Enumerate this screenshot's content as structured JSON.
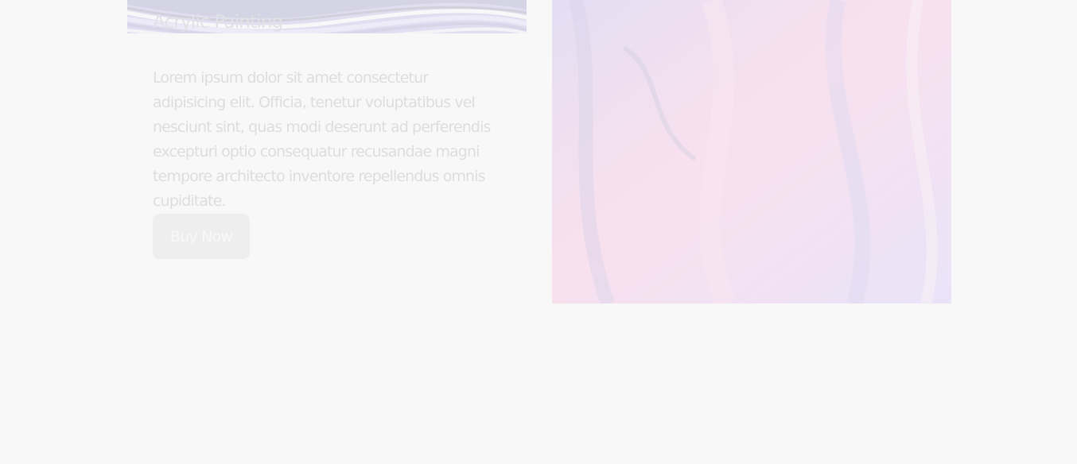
{
  "card": {
    "title": "Acrylic Painting",
    "description": "Lorem ipsum dolor sit amet consectetur adipisicing elit. Officia, tenetur voluptatibus vel nesciunt sint, quas modi deserunt ad perferendis excepturi optio consequatur recusandae magni tempore architecto inventore repellendus omnis cupiditate.",
    "button_label": "Buy Now"
  },
  "colors": {
    "overlay": "#f7f7f7",
    "button": "#c8c8c8",
    "text": "#666a70",
    "accent_purple": "#4b2a8a",
    "accent_red": "#9b1a3c"
  }
}
